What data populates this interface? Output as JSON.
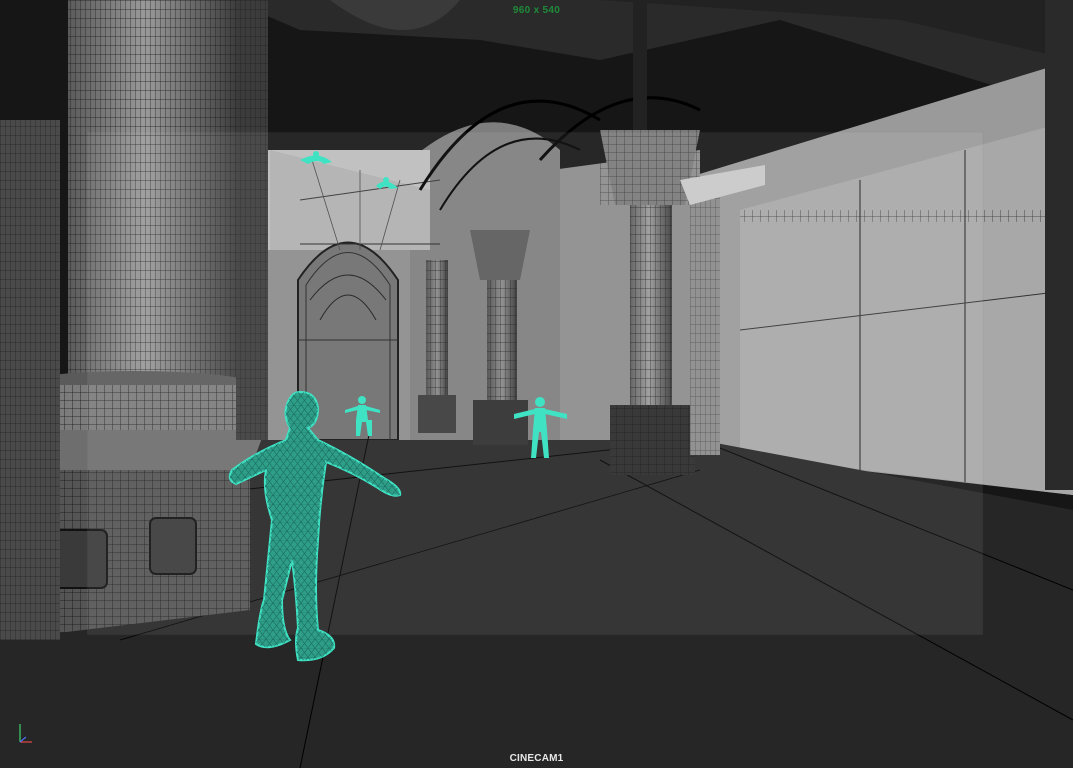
{
  "viewport": {
    "camera_name": "CINECAM1",
    "resolution_gate": "960 x 540"
  },
  "colors": {
    "character_wireframe": "#3fe3c4",
    "resolution_label": "#1f8a3a",
    "background": "#1a1a1a"
  },
  "icons": {
    "axis_gizmo": "axis-gizmo-icon"
  }
}
